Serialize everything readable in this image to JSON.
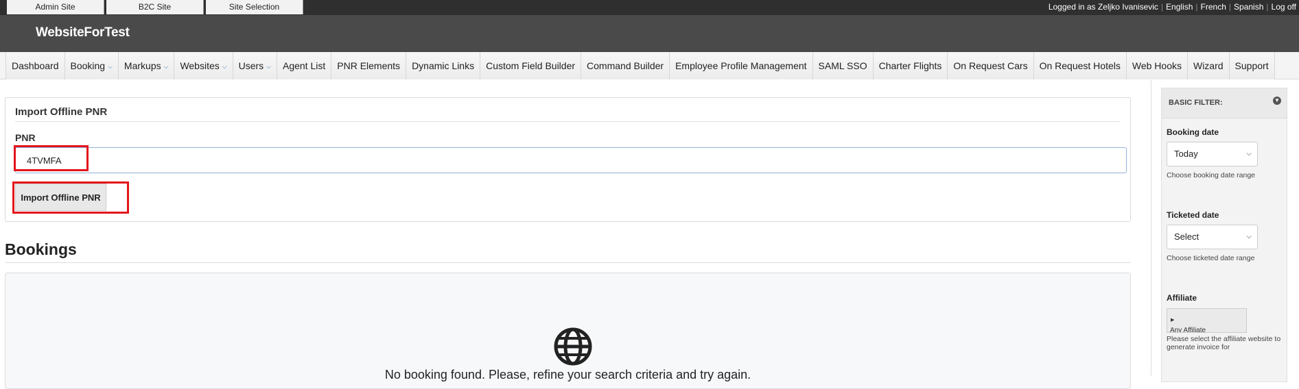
{
  "top_tabs": [
    "Admin Site",
    "B2C Site",
    "Site Selection"
  ],
  "account": {
    "logged_in_text": "Logged in as Zeljko Ivanisevic",
    "languages": [
      "English",
      "French",
      "Spanish"
    ],
    "logoff": "Log off"
  },
  "site_title": "WebsiteForTest",
  "nav": [
    {
      "label": "Dashboard",
      "dropdown": false
    },
    {
      "label": "Booking",
      "dropdown": true
    },
    {
      "label": "Markups",
      "dropdown": true
    },
    {
      "label": "Websites",
      "dropdown": true
    },
    {
      "label": "Users",
      "dropdown": true
    },
    {
      "label": "Agent List",
      "dropdown": false
    },
    {
      "label": "PNR Elements",
      "dropdown": false
    },
    {
      "label": "Dynamic Links",
      "dropdown": false
    },
    {
      "label": "Custom Field Builder",
      "dropdown": false
    },
    {
      "label": "Command Builder",
      "dropdown": false
    },
    {
      "label": "Employee Profile Management",
      "dropdown": false
    },
    {
      "label": "SAML SSO",
      "dropdown": false
    },
    {
      "label": "Charter Flights",
      "dropdown": false
    },
    {
      "label": "On Request Cars",
      "dropdown": false
    },
    {
      "label": "On Request Hotels",
      "dropdown": false
    },
    {
      "label": "Web Hooks",
      "dropdown": false
    },
    {
      "label": "Wizard",
      "dropdown": false
    },
    {
      "label": "Support",
      "dropdown": false
    }
  ],
  "import_panel": {
    "title": "Import Offline PNR",
    "pnr_label": "PNR",
    "pnr_value": "4TVMFA",
    "button_label": "Import Offline PNR"
  },
  "bookings": {
    "title": "Bookings",
    "empty_message": "No booking found. Please, refine your search criteria and try again.",
    "empty_icon": "globe-icon"
  },
  "sidebar": {
    "title": "BASIC FILTER:",
    "booking_date": {
      "label": "Booking date",
      "value": "Today",
      "help": "Choose booking date range"
    },
    "ticketed_date": {
      "label": "Ticketed date",
      "value": "Select",
      "help": "Choose ticketed date range"
    },
    "affiliate": {
      "label": "Affiliate",
      "value": "Any Affiliate",
      "help": "Please select the affiliate website to generate invoice for"
    }
  },
  "colors": {
    "topbar": "#2f2f2f",
    "header": "#4a4a4a",
    "highlight": "#e3141b",
    "caret": "#2a6ebd"
  }
}
